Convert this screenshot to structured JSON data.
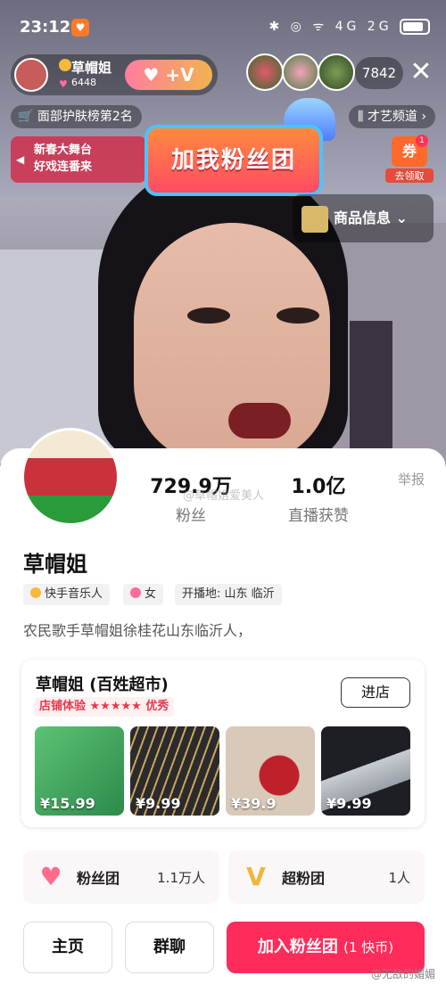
{
  "status": {
    "time": "23:12",
    "icons": "✱ ◎ ᯤ 4G 2G"
  },
  "host": {
    "name": "草帽姐",
    "likes": "6448",
    "follow_label": "+V"
  },
  "viewers": {
    "count": "7842"
  },
  "chips": {
    "rank": "面部护肤榜第2名",
    "channel": "才艺频道 ›"
  },
  "banner": {
    "line1": "新春大舞台",
    "line2": "好戏连番来"
  },
  "fan_banner": "加我粉丝团",
  "coupon": {
    "label": "券",
    "badge": "1",
    "action": "去领取"
  },
  "goods_info": "商品信息 ⌄",
  "profile": {
    "fans_num": "729.9万",
    "fans_lbl": "粉丝",
    "likes_num": "1.0亿",
    "likes_lbl": "直播获赞",
    "report": "举报",
    "watermark": "@草帽姐爱美人",
    "name": "草帽姐",
    "tags": [
      "快手音乐人",
      "女",
      "开播地: 山东 临沂"
    ],
    "bio": "农民歌手草帽姐徐桂花山东临沂人，"
  },
  "shop": {
    "name": "草帽姐 (百姓超市)",
    "rating_label": "店铺体验 ★★★★★ 优秀",
    "enter": "进店",
    "products": [
      {
        "price": "¥15.99",
        "color": "#4aa86a"
      },
      {
        "price": "¥9.99",
        "color": "#2b2b2d"
      },
      {
        "price": "¥39.9",
        "color": "#d9c9b9"
      },
      {
        "price": "¥9.99",
        "color": "#1e1f24"
      }
    ]
  },
  "fan_group": {
    "title": "粉丝团",
    "count": "1.1万人"
  },
  "super_fans": {
    "title": "超粉团",
    "count": "1人"
  },
  "buttons": {
    "home": "主页",
    "chat": "群聊",
    "join": "加入粉丝团",
    "join_price": "(1 快币)"
  },
  "corner_mark": "@无敌的媚媚",
  "colors": {
    "accent": "#ff2b5a",
    "rating": "#e53a4a"
  }
}
